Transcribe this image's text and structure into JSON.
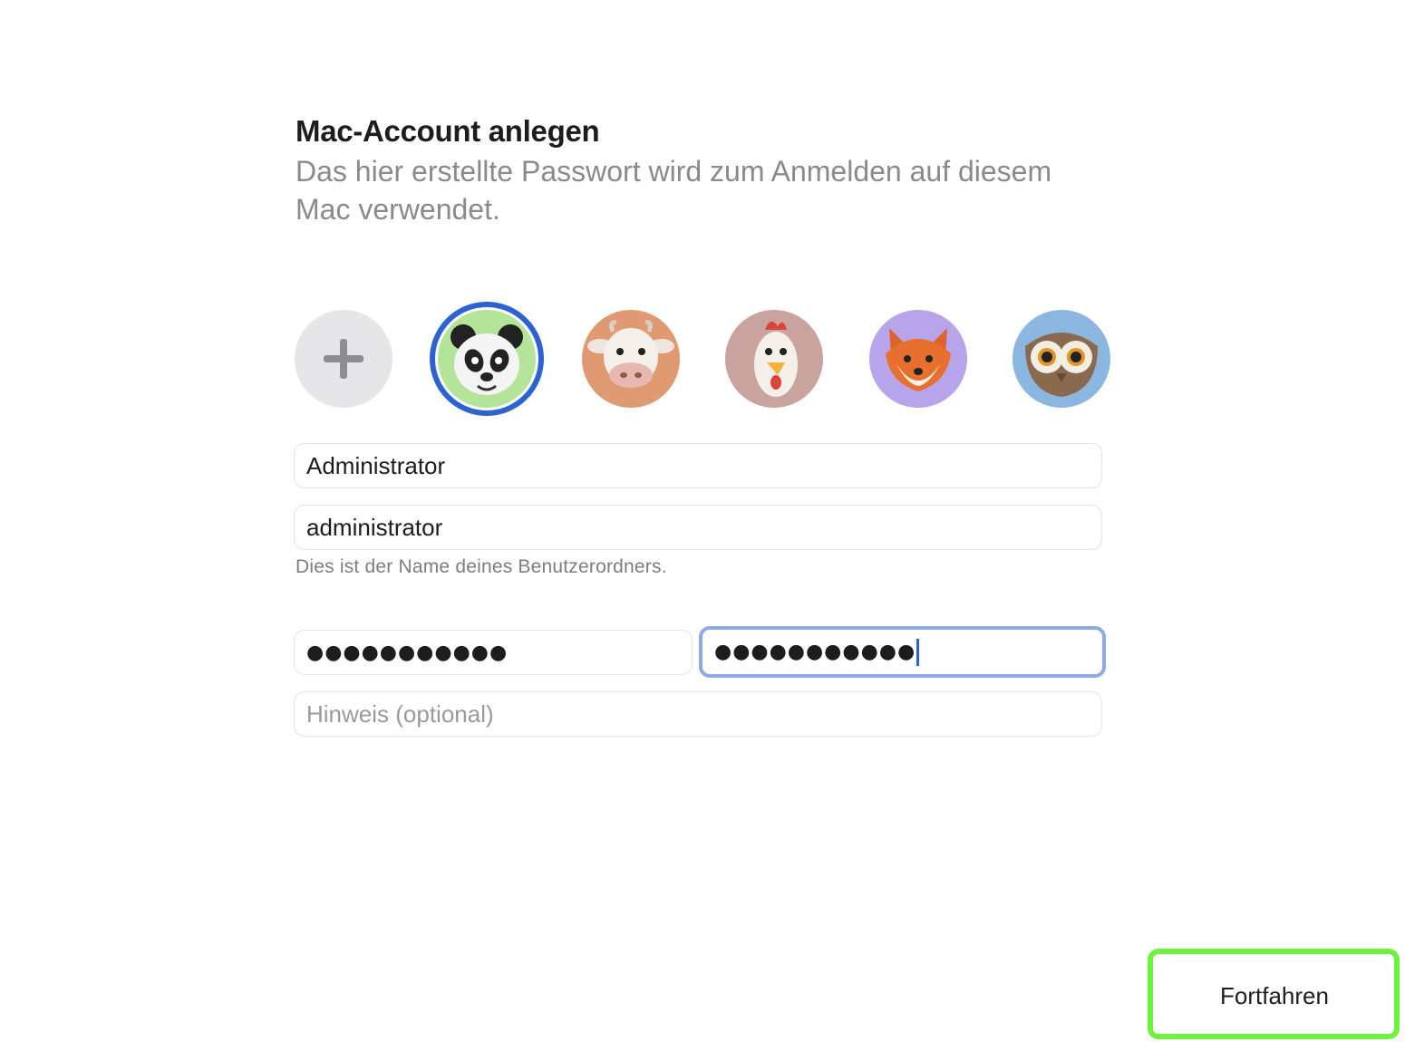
{
  "header": {
    "title": "Mac-Account anlegen",
    "subtitle": "Das hier erstellte Passwort wird zum Anmelden auf diesem Mac verwendet."
  },
  "avatars": {
    "items": [
      {
        "name": "add",
        "icon": "plus-icon",
        "color": "#e6e6e8"
      },
      {
        "name": "panda",
        "icon": "panda-icon",
        "color": "#b4e49a",
        "selected": true
      },
      {
        "name": "cow",
        "icon": "cow-icon",
        "color": "#e09a72"
      },
      {
        "name": "chicken",
        "icon": "chicken-icon",
        "color": "#c9a39e"
      },
      {
        "name": "fox",
        "icon": "fox-icon",
        "color": "#b7a4ea"
      },
      {
        "name": "owl",
        "icon": "owl-icon",
        "color": "#8ab6e0"
      }
    ],
    "selected_color": "#2d62d2"
  },
  "form": {
    "full_name": "Administrator",
    "account_name": "administrator",
    "account_name_hint": "Dies ist der Name deines Benutzerordners.",
    "password": "●●●●●●●●●●●",
    "password_verify": "●●●●●●●●●●●",
    "hint_placeholder": "Hinweis (optional)"
  },
  "footer": {
    "continue_label": "Fortfahren",
    "highlight_color": "#6ef23e"
  }
}
